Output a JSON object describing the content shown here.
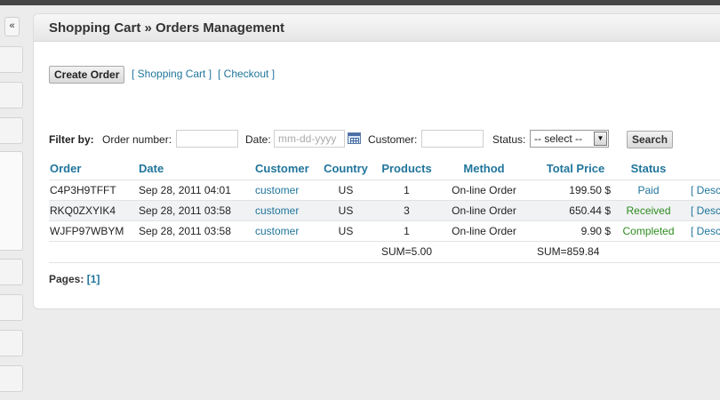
{
  "header": {
    "title": "Shopping Cart » Orders Management",
    "collapse_glyph": "«"
  },
  "actions": {
    "create_order": "Create Order",
    "links": [
      "[ Shopping Cart ]",
      "[ Checkout ]"
    ]
  },
  "filter": {
    "label": "Filter by:",
    "order_number_label": "Order number:",
    "order_number_value": "",
    "date_label": "Date:",
    "date_placeholder": "mm-dd-yyyy",
    "customer_label": "Customer:",
    "customer_value": "",
    "status_label": "Status:",
    "status_selected": "-- select --",
    "search": "Search"
  },
  "table": {
    "columns": [
      "Order",
      "Date",
      "Customer",
      "Country",
      "Products",
      "Method",
      "Total Price",
      "Status"
    ],
    "rows": [
      {
        "order": "C4P3H9TFFT",
        "date": "Sep 28, 2011 04:01",
        "customer": "customer",
        "country": "US",
        "products": "1",
        "method": "On-line Order",
        "total": "199.50 $",
        "status": "Paid",
        "action": "[ Desc"
      },
      {
        "order": "RKQ0ZXYIK4",
        "date": "Sep 28, 2011 03:58",
        "customer": "customer",
        "country": "US",
        "products": "3",
        "method": "On-line Order",
        "total": "650.44 $",
        "status": "Received",
        "action": "[ Desc"
      },
      {
        "order": "WJFP97WBYM",
        "date": "Sep 28, 2011 03:58",
        "customer": "customer",
        "country": "US",
        "products": "1",
        "method": "On-line Order",
        "total": "9.90 $",
        "status": "Completed",
        "action": "[ Desc"
      }
    ],
    "sum_products": "SUM=5.00",
    "sum_total": "SUM=859.84"
  },
  "pagination": {
    "label": "Pages:",
    "current": "[1]"
  },
  "colors": {
    "link": "#21759b",
    "status_green": "#2e8b1f",
    "top_bar": "#464646"
  }
}
